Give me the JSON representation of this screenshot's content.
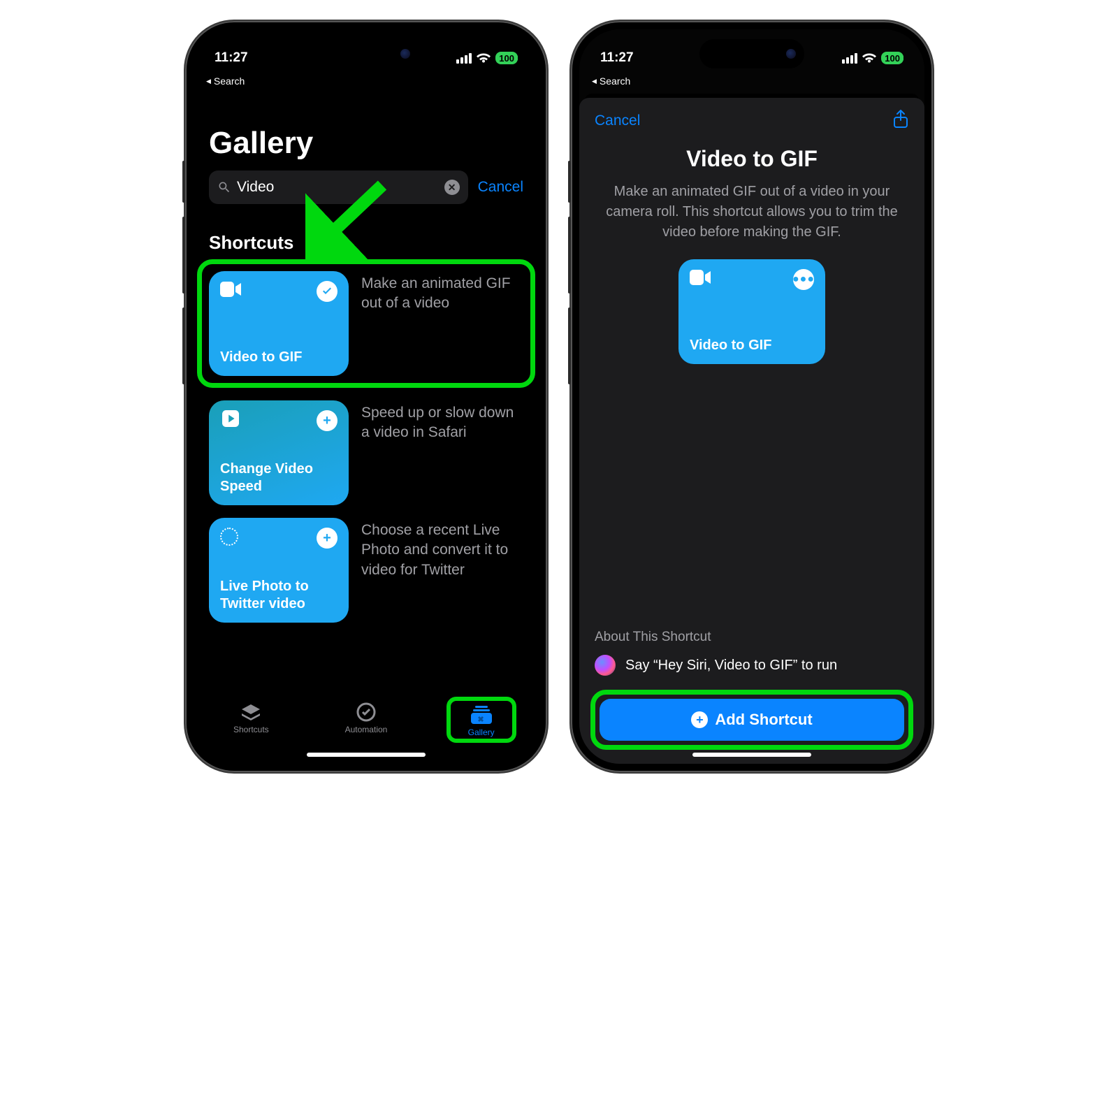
{
  "status": {
    "time": "11:27",
    "battery": "100",
    "breadcrumb": "Search"
  },
  "left": {
    "title": "Gallery",
    "search": {
      "value": "Video",
      "cancel": "Cancel"
    },
    "section": "Shortcuts",
    "items": [
      {
        "name": "Video to GIF",
        "desc": "Make an animated GIF out of a video",
        "icon": "video",
        "action": "check",
        "highlighted": true,
        "color": "blue"
      },
      {
        "name": "Change Video Speed",
        "desc": "Speed up or slow down a video in Safari",
        "icon": "play",
        "action": "plus",
        "highlighted": false,
        "color": "teal"
      },
      {
        "name": "Live Photo to Twitter video",
        "desc": "Choose a recent Live Photo and convert it to video for Twitter",
        "icon": "dotted",
        "action": "plus",
        "highlighted": false,
        "color": "blue"
      }
    ],
    "tabs": [
      {
        "label": "Shortcuts",
        "icon": "stack",
        "active": false
      },
      {
        "label": "Automation",
        "icon": "clock",
        "active": false
      },
      {
        "label": "Gallery",
        "icon": "gallery",
        "active": true,
        "highlighted": true
      }
    ]
  },
  "right": {
    "cancel": "Cancel",
    "title": "Video to GIF",
    "desc": "Make an animated GIF out of a video in your camera roll. This shortcut allows you to trim the video before making the GIF.",
    "card_name": "Video to GIF",
    "about_title": "About This Shortcut",
    "siri_text": "Say “Hey Siri, Video to GIF” to run",
    "add_label": "Add Shortcut"
  }
}
